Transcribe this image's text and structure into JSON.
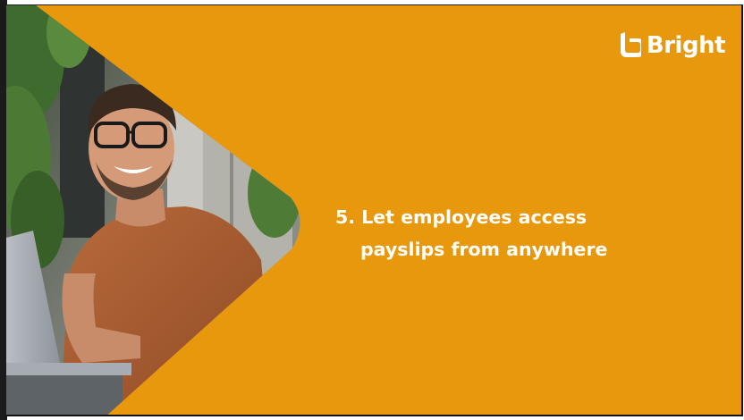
{
  "slide": {
    "background_color": "#e8980c",
    "logo": {
      "icon": "bright-logo-icon",
      "text": "Bright"
    },
    "headline": {
      "line1": "5. Let employees access",
      "line2": "payslips from anywhere"
    },
    "photo": {
      "description_icon": "person-with-laptop-photo"
    }
  }
}
